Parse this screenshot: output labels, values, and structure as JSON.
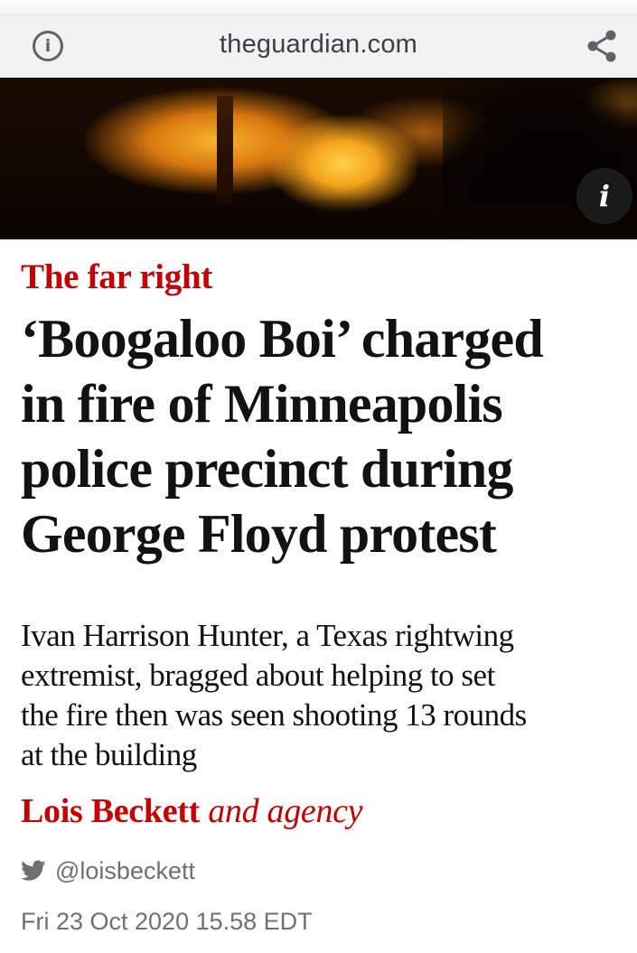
{
  "browser": {
    "url": "theguardian.com",
    "icons": {
      "site_info": "info-circle-icon",
      "share": "share-icon"
    }
  },
  "hero": {
    "info_button_glyph": "i"
  },
  "article": {
    "kicker": "The far right",
    "headline_lines": [
      "‘Boogaloo Boi’ charged",
      "in fire of Minneapolis",
      "police precinct during",
      "George Floyd protest"
    ],
    "standfirst_lines": [
      "Ivan Harrison Hunter, a Texas rightwing",
      "extremist, bragged about helping to set",
      "the fire then was seen shooting 13 rounds",
      "at the building"
    ],
    "byline": {
      "author": "Lois Beckett",
      "agency": "and agency"
    },
    "twitter_handle": "@loisbeckett",
    "dateline": "Fri 23 Oct 2020 15.58 EDT"
  },
  "colors": {
    "kicker_red": "#c70000",
    "headline_text": "#121212",
    "meta_gray": "#707070",
    "url_bar_bg": "#f2f2f2"
  }
}
